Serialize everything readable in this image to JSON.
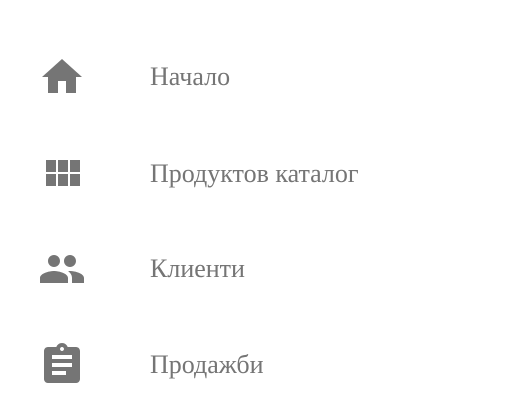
{
  "colors": {
    "icon": "#757575",
    "text": "#757575",
    "background": "#ffffff"
  },
  "menu": {
    "items": [
      {
        "label": "Начало",
        "icon": "home-icon"
      },
      {
        "label": "Продуктов каталог",
        "icon": "grid-icon"
      },
      {
        "label": "Клиенти",
        "icon": "people-icon"
      },
      {
        "label": "Продажби",
        "icon": "clipboard-icon"
      }
    ]
  }
}
